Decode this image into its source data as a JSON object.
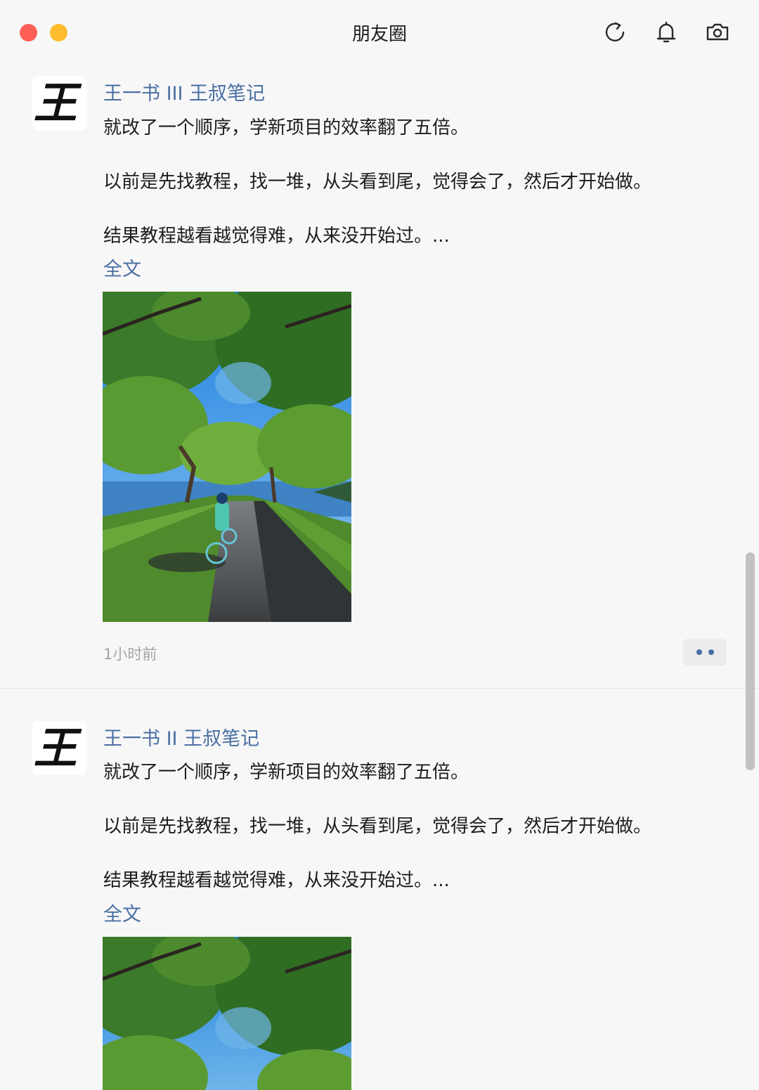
{
  "window": {
    "title": "朋友圈"
  },
  "toolbar": {
    "icons": [
      "refresh-icon",
      "bell-icon",
      "camera-icon"
    ]
  },
  "posts": [
    {
      "author": "王一书 III 王叔笔记",
      "avatar_glyph": "王",
      "paragraphs": [
        "就改了一个顺序，学新项目的效率翻了五倍。",
        "以前是先找教程，找一堆，从头看到尾，觉得会了，然后才开始做。",
        "结果教程越看越觉得难，从来没开始过。..."
      ],
      "full_text_label": "全文",
      "time": "1小时前"
    },
    {
      "author": "王一书 II 王叔笔记",
      "avatar_glyph": "王",
      "paragraphs": [
        "就改了一个顺序，学新项目的效率翻了五倍。",
        "以前是先找教程，找一堆，从头看到尾，觉得会了，然后才开始做。",
        "结果教程越看越觉得难，从来没开始过。..."
      ],
      "full_text_label": "全文"
    }
  ],
  "colors": {
    "link": "#4a6fa3",
    "close": "#fe5f57",
    "minimize": "#febc2e"
  }
}
